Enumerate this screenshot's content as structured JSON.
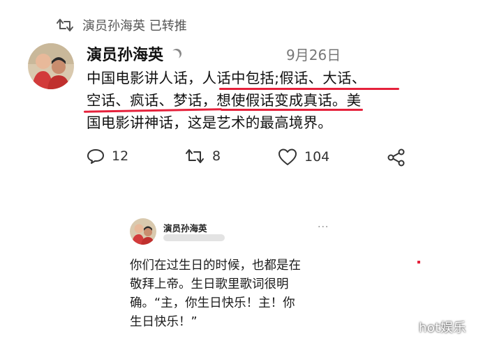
{
  "retweet": {
    "label": "演员孙海英 已转推"
  },
  "post": {
    "author": "演员孙海英",
    "date": "9月26日",
    "lines": [
      "中国电影讲人话，人话中包括;假话、大话、",
      "空话、疯话、梦话，想使假话变成真话。美",
      "国电影讲神话，这是艺术的最高境界。"
    ],
    "actions": {
      "replies": "12",
      "retweets": "8",
      "likes": "104"
    }
  },
  "embedded": {
    "author": "演员孙海英",
    "lines": [
      "你们在过生日的时候，也都是在",
      "敬拜上帝。生日歌里歌词很明",
      "确。“主，你生日快乐！主！你",
      "生日快乐！”"
    ]
  },
  "watermark": "hot娱乐",
  "colors": {
    "underline": "#e5213b",
    "text": "#111111",
    "muted": "#777777"
  },
  "icons": [
    "retweet-icon",
    "moon-icon",
    "reply-icon",
    "retweet-icon",
    "heart-icon",
    "share-icon",
    "more-icon"
  ]
}
